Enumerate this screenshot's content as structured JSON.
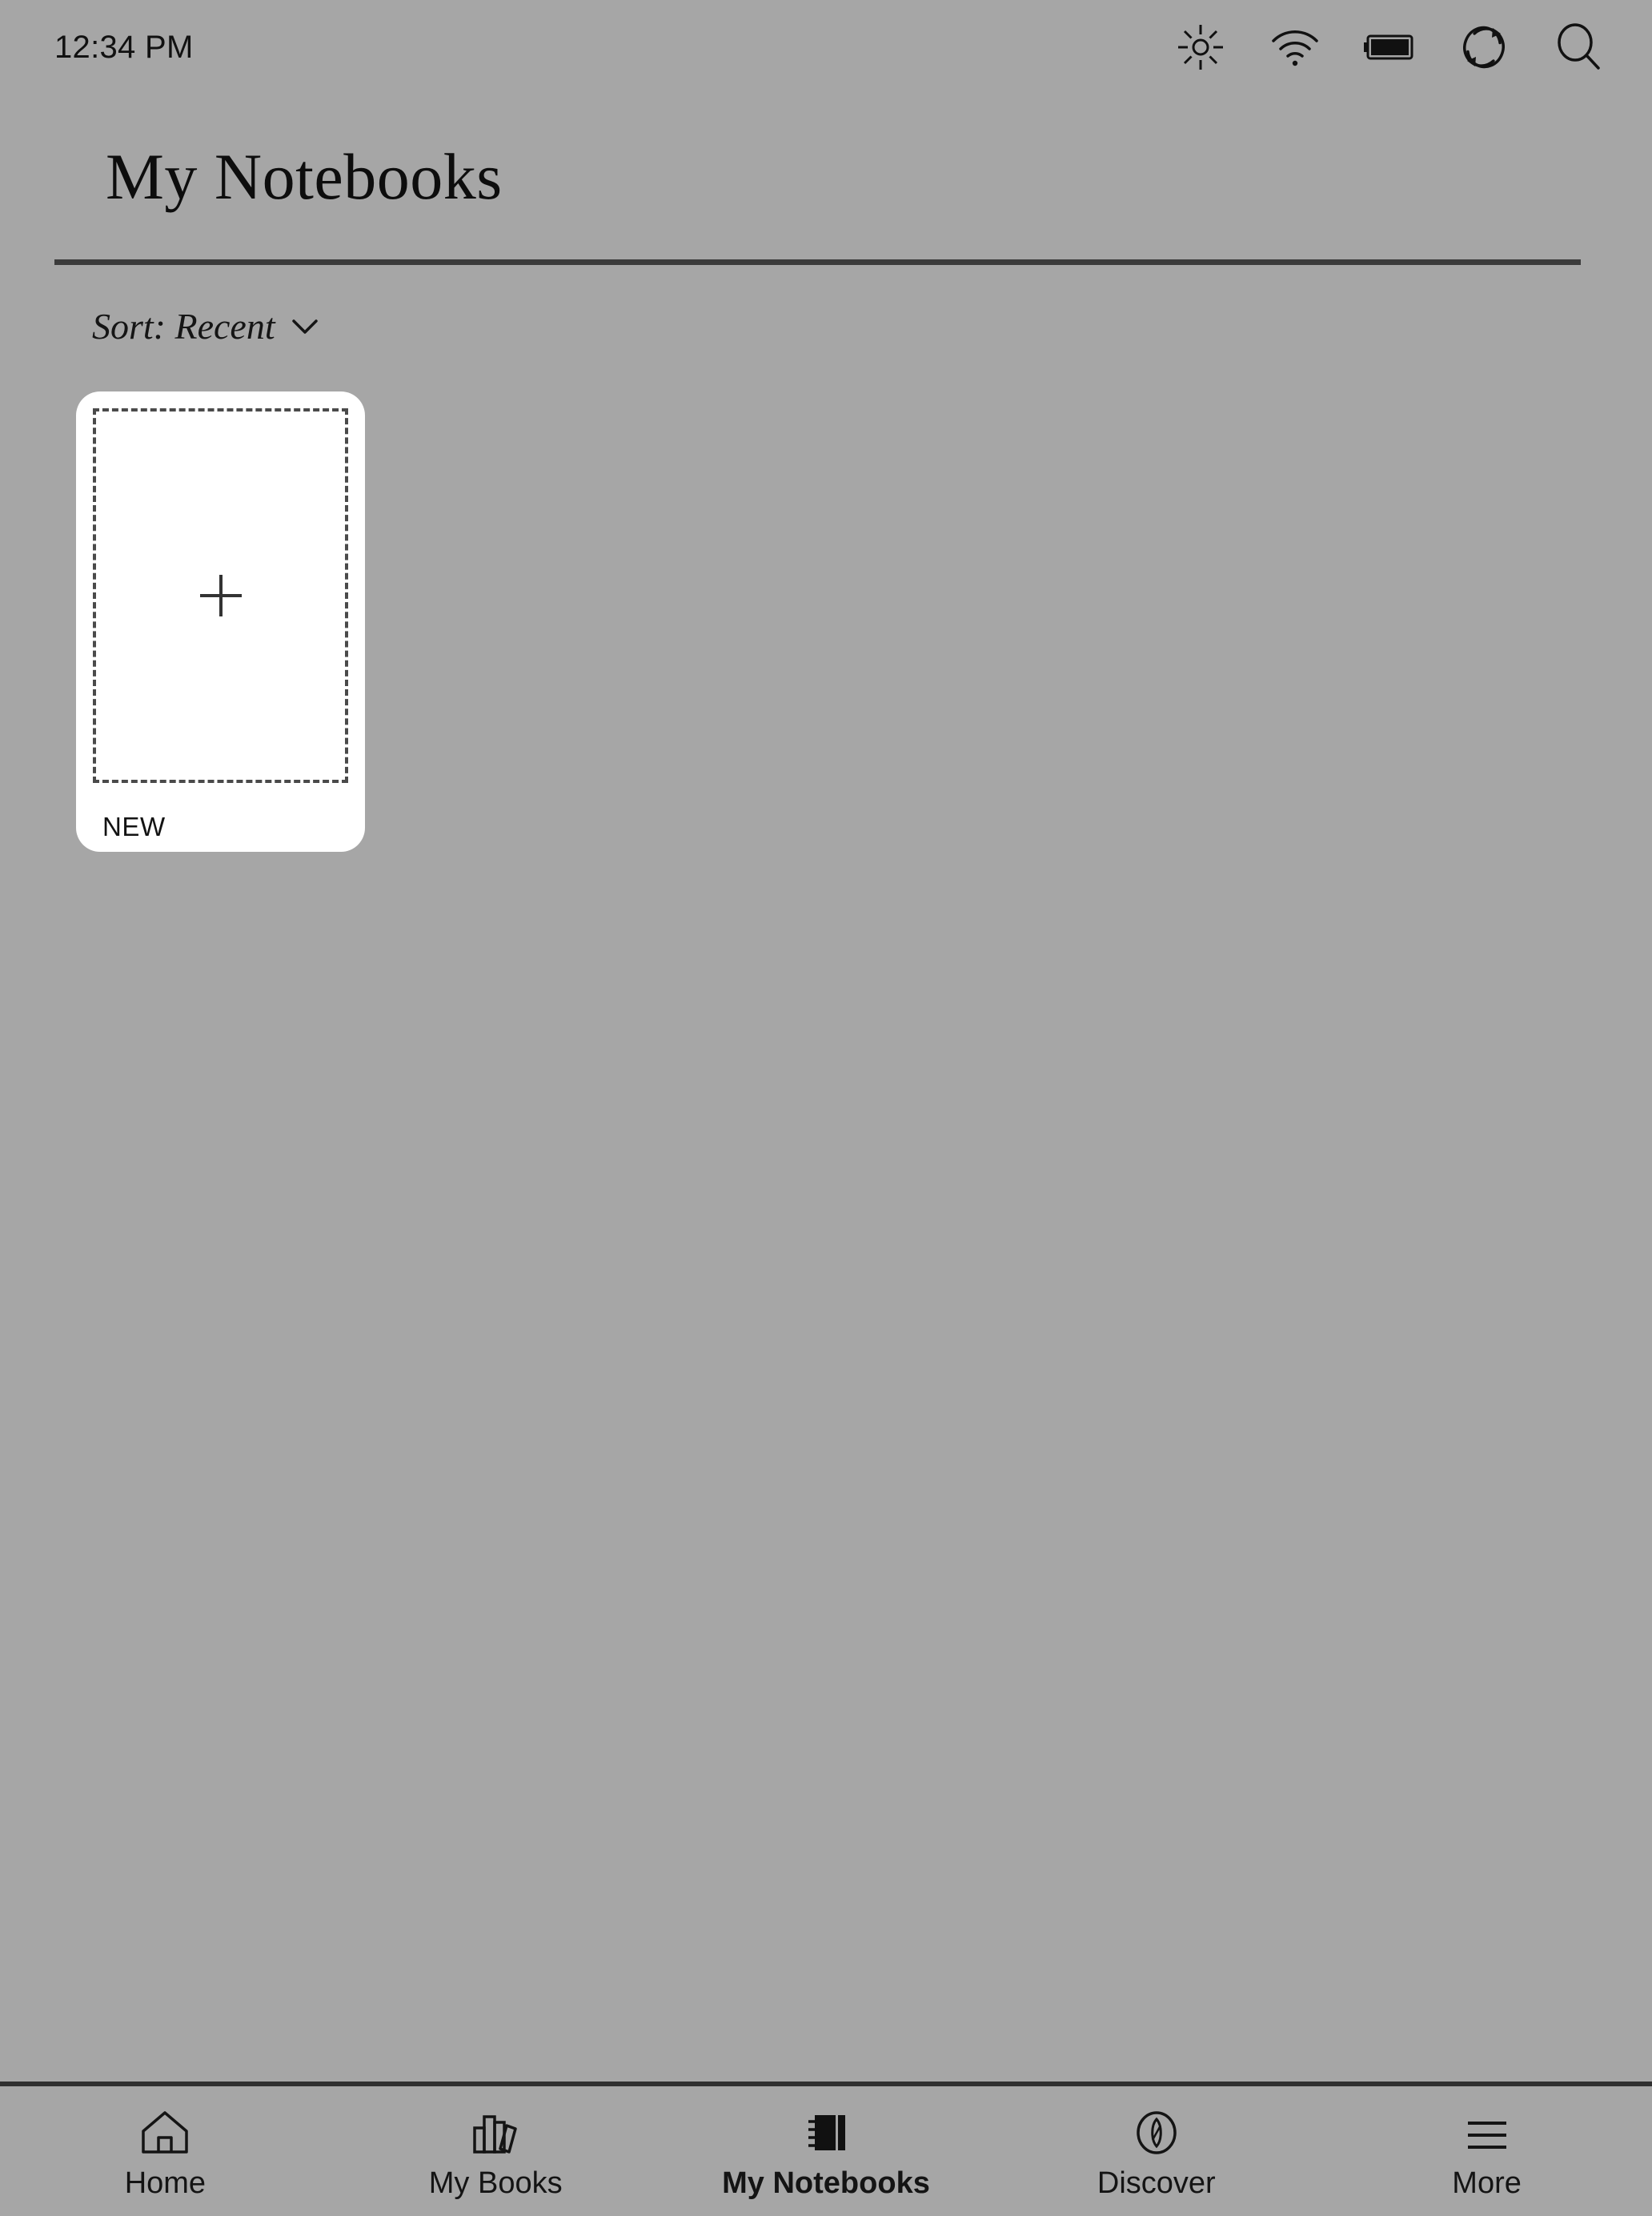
{
  "status_bar": {
    "time": "12:34 PM",
    "icons": [
      {
        "name": "brightness-icon",
        "label": "Brightness"
      },
      {
        "name": "wifi-icon",
        "label": "Wi-Fi"
      },
      {
        "name": "battery-icon",
        "label": "Battery"
      },
      {
        "name": "sync-icon",
        "label": "Sync"
      },
      {
        "name": "search-icon",
        "label": "Search"
      }
    ]
  },
  "header": {
    "title": "My Notebooks"
  },
  "sort": {
    "label": "Sort: Recent",
    "chevron": "chevron-down-icon"
  },
  "grid": {
    "cards": [
      {
        "name": "new-notebook-card",
        "label": "NEW",
        "icon": "plus-icon"
      }
    ]
  },
  "bottom_nav": {
    "items": [
      {
        "label": "Home",
        "icon": "home-icon",
        "active": false
      },
      {
        "label": "My Books",
        "icon": "books-icon",
        "active": false
      },
      {
        "label": "My Notebooks",
        "icon": "notebook-icon",
        "active": true
      },
      {
        "label": "Discover",
        "icon": "compass-icon",
        "active": false
      },
      {
        "label": "More",
        "icon": "hamburger-icon",
        "active": false
      }
    ]
  },
  "colors": {
    "background": "#a6a6a6",
    "card": "#ffffff",
    "ink": "#111111",
    "rule": "#3b3b3b",
    "dash": "#4a4a4a"
  }
}
